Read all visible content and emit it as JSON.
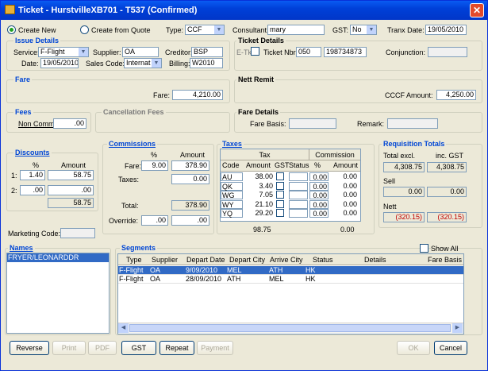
{
  "window": {
    "title": "Ticket - HurstvilleXB701 - T537 (Confirmed)",
    "close": "✕"
  },
  "top": {
    "create_new": "Create New",
    "create_from_quote": "Create from Quote",
    "type_label": "Type:",
    "type_value": "CCF",
    "consultant_label": "Consultant:",
    "consultant_value": "mary",
    "gst_label": "GST:",
    "gst_value": "No",
    "tranx_label": "Tranx Date:",
    "tranx_value": "19/05/2010"
  },
  "issue": {
    "title": "Issue Details",
    "service_label": "Service:",
    "service_value": "F-Flight",
    "supplier_label": "Supplier:",
    "supplier_value": "OA",
    "creditor_label": "Creditor:",
    "creditor_value": "BSP",
    "date_label": "Date:",
    "date_value": "19/05/2010",
    "sales_label": "Sales Code:",
    "sales_value": "Internat",
    "billing_label": "Billing:",
    "billing_value": "W2010"
  },
  "ticket": {
    "title": "Ticket Details",
    "etkt_label": "E-Tkt",
    "nbr_label": "Ticket Nbr:",
    "nbr_value": "050",
    "nbr_value2": "198734873",
    "conj_label": "Conjunction:",
    "conj_value": ""
  },
  "fare": {
    "title": "Fare",
    "fare_label": "Fare:",
    "fare_value": "4,210.00"
  },
  "nett": {
    "title": "Nett Remit",
    "amount_label": "CCCF Amount:",
    "amount_value": "4,250.00"
  },
  "fees": {
    "title": "Fees",
    "noncomm_label": "Non Comm:",
    "noncomm_value": ".00"
  },
  "cancel": {
    "title": "Cancellation Fees"
  },
  "faredet": {
    "title": "Fare Details",
    "basis_label": "Fare Basis:",
    "basis_value": "",
    "remark_label": "Remark:",
    "remark_value": ""
  },
  "discounts": {
    "title": "Discounts",
    "pct_header": "%",
    "amt_header": "Amount",
    "rows": [
      {
        "idx": "1:",
        "pct": "1.40",
        "amt": "58.75"
      },
      {
        "idx": "2:",
        "pct": ".00",
        "amt": ".00"
      }
    ],
    "total": "58.75"
  },
  "commissions": {
    "title": "Commissions",
    "pct_header": "%",
    "amt_header": "Amount",
    "fare_label": "Fare:",
    "fare_pct": "9.00",
    "fare_amt": "378.90",
    "taxes_label": "Taxes:",
    "taxes_amt": "0.00",
    "total_label": "Total:",
    "total_amt": "378.90",
    "override_label": "Override:",
    "override_pct": ".00",
    "override_amt": ".00"
  },
  "taxes": {
    "title": "Taxes",
    "tax_header": "Tax",
    "comm_header": "Commission",
    "cols": [
      "Code",
      "Amount",
      "GST",
      "Status",
      "%",
      "Amount"
    ],
    "rows": [
      {
        "code": "AU",
        "amount": "38.00",
        "pct": "0.00",
        "camt": "0.00"
      },
      {
        "code": "QK",
        "amount": "3.40",
        "pct": "0.00",
        "camt": "0.00"
      },
      {
        "code": "WG",
        "amount": "7.05",
        "pct": "0.00",
        "camt": "0.00"
      },
      {
        "code": "WY",
        "amount": "21.10",
        "pct": "0.00",
        "camt": "0.00"
      },
      {
        "code": "YQ",
        "amount": "29.20",
        "pct": "0.00",
        "camt": "0.00"
      }
    ],
    "total": "98.75",
    "comm_total": "0.00"
  },
  "req": {
    "title": "Requisition Totals",
    "excl_label": "Total excl.",
    "inc_label": "inc. GST",
    "total_excl": "4,308.75",
    "total_inc": "4,308.75",
    "sell_label": "Sell",
    "sell_excl": "0.00",
    "sell_inc": "0.00",
    "nett_label": "Nett",
    "nett_excl": "(320.15)",
    "nett_inc": "(320.15)"
  },
  "marketing": {
    "label": "Marketing Code:",
    "value": ""
  },
  "names": {
    "title": "Names",
    "items": [
      "FRYER/LEONARDDR"
    ]
  },
  "segments": {
    "title": "Segments",
    "show_all": "Show All",
    "cols": [
      "Type",
      "Supplier",
      "Depart Date",
      "Depart City",
      "Arrive City",
      "Status",
      "Details",
      "Fare Basis"
    ],
    "rows": [
      {
        "type": "F-Flight",
        "supplier": "OA",
        "date": "9/09/2010",
        "dep": "MEL",
        "arr": "ATH",
        "status": "HK",
        "details": "",
        "basis": ""
      },
      {
        "type": "F-Flight",
        "supplier": "OA",
        "date": "28/09/2010",
        "dep": "ATH",
        "arr": "MEL",
        "status": "HK",
        "details": "",
        "basis": ""
      }
    ]
  },
  "buttons": {
    "reverse": "Reverse",
    "print": "Print",
    "pdf": "PDF",
    "gst": "GST",
    "repeat": "Repeat",
    "payment": "Payment",
    "ok": "OK",
    "cancel": "Cancel"
  },
  "colors": {
    "titlebar": "#0a5bf2",
    "group_title": "#0046d5",
    "selection": "#316ac5",
    "negative": "#c00000"
  }
}
